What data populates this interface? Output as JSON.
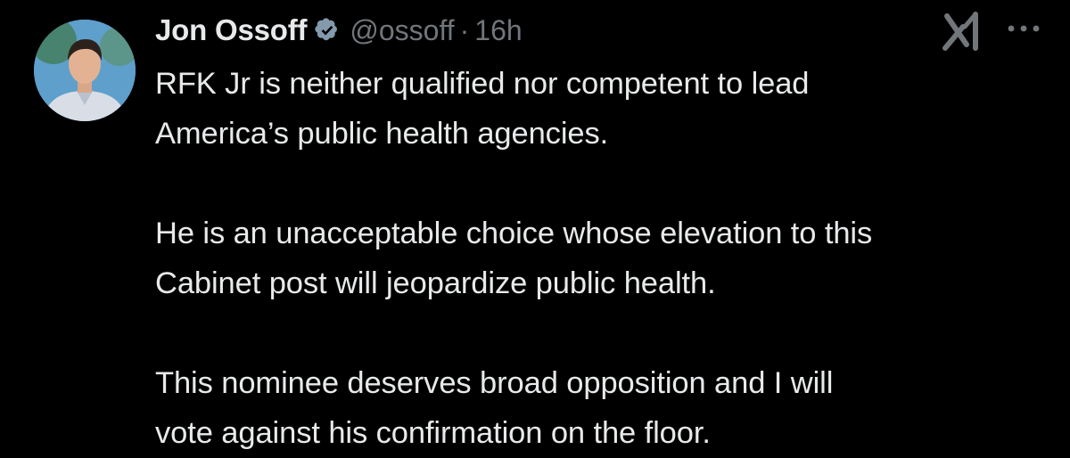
{
  "tweet": {
    "author": {
      "display_name": "Jon Ossoff",
      "handle": "@ossoff",
      "verified": true,
      "avatar_icon": "profile-photo"
    },
    "separator": "·",
    "timestamp": "16h",
    "icons": {
      "grok": "grok-icon",
      "more": "more-icon"
    },
    "body": {
      "paragraphs": [
        {
          "lines": [
            "RFK Jr is neither qualified nor competent to lead",
            "America’s public health agencies."
          ]
        },
        {
          "lines": [
            "He is an unacceptable choice whose elevation to this",
            "Cabinet post will jeopardize public health."
          ]
        },
        {
          "lines": [
            "This nominee deserves broad opposition and I will",
            "vote against his confirmation on the floor."
          ]
        }
      ]
    }
  },
  "colors": {
    "background": "#000000",
    "text_primary": "#e7e9ea",
    "text_secondary": "#71767b",
    "verified_badge": "#829aab"
  }
}
